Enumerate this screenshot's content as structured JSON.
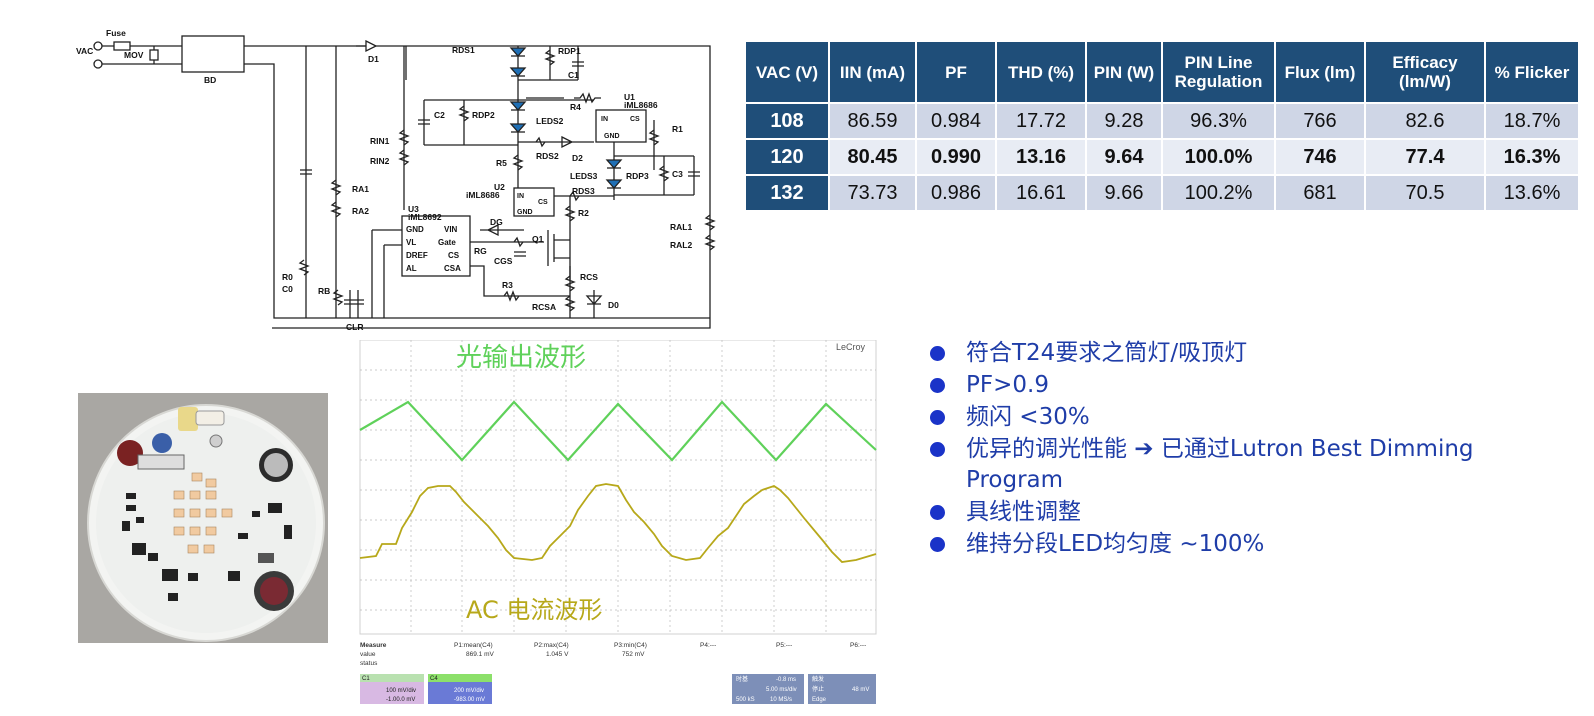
{
  "schematic": {
    "labels": {
      "fuse": "Fuse",
      "vac": "VAC",
      "mov": "MOV",
      "bd": "BD",
      "d1": "D1",
      "rds1": "RDS1",
      "rdp1": "RDP1",
      "c1": "C1",
      "c2": "C2",
      "rdp2": "RDP2",
      "r4": "R4",
      "u1": "U1",
      "u1_part": "iML8686",
      "u1_in": "IN",
      "u1_cs": "CS",
      "u1_gnd": "GND",
      "leds2": "LEDS2",
      "r1": "R1",
      "rin1": "RIN1",
      "rin2": "RIN2",
      "r5": "R5",
      "rds2": "RDS2",
      "d2": "D2",
      "leds3": "LEDS3",
      "rdp3": "RDP3",
      "c3": "C3",
      "u2": "U2",
      "u2_part": "iML8686",
      "u2_in": "IN",
      "u2_cs": "CS",
      "u2_gnd": "GND",
      "rds3": "RDS3",
      "r2": "R2",
      "ra1": "RA1",
      "ra2": "RA2",
      "u3": "U3",
      "u3_part": "iML8692",
      "u3_gnd": "GND",
      "u3_vin": "VIN",
      "u3_vl": "VL",
      "u3_gate": "Gate",
      "u3_dref": "DREF",
      "u3_cs": "CS",
      "u3_al": "AL",
      "u3_csa": "CSA",
      "dg": "DG",
      "q1": "Q1",
      "rg": "RG",
      "cgs": "CGS",
      "ral1": "RAL1",
      "ral2": "RAL2",
      "r0": "R0",
      "c0": "C0",
      "rb": "RB",
      "rcs": "RCS",
      "r3": "R3",
      "rcsa": "RCSA",
      "d0": "D0",
      "clr": "CLR"
    }
  },
  "table": {
    "headers": [
      "VAC (V)",
      "IIN (mA)",
      "PF",
      "THD (%)",
      "PIN (W)",
      "PIN Line Regulation",
      "Flux (lm)",
      "Efficacy (lm/W)",
      "% Flicker"
    ],
    "rows": [
      [
        "108",
        "86.59",
        "0.984",
        "17.72",
        "9.28",
        "96.3%",
        "766",
        "82.6",
        "18.7%"
      ],
      [
        "120",
        "80.45",
        "0.990",
        "13.16",
        "9.64",
        "100.0%",
        "746",
        "77.4",
        "16.3%"
      ],
      [
        "132",
        "73.73",
        "0.986",
        "16.61",
        "9.66",
        "100.2%",
        "681",
        "70.5",
        "13.6%"
      ]
    ]
  },
  "scope": {
    "brand": "LeCroy",
    "light_label": "光输出波形",
    "current_label": "AC 电流波形",
    "light_color": "#5fd15a",
    "current_color": "#b7a81a",
    "measure": {
      "title": "Measure",
      "value": "value",
      "status": "status",
      "p1_name": "P1:mean(C4)",
      "p1_value": "869.1 mV",
      "p2_name": "P2:max(C4)",
      "p2_value": "1.045 V",
      "p3_name": "P3:min(C4)",
      "p3_value": "752 mV",
      "p4": "P4:---",
      "p5": "P5:---",
      "p6": "P6:---"
    },
    "ch1": {
      "name": "C1",
      "line1": "100 mV/div",
      "line2": "-1.00.0 mV"
    },
    "ch4": {
      "name": "C4",
      "line1": "200 mV/div",
      "line2": "-983.00 mV"
    },
    "timebase": {
      "t1": "时基",
      "t1v": "-0.8 ms",
      "t2": "5.00 ms/div",
      "t3": "500 kS",
      "t3v": "10 MS/s"
    },
    "trigger": {
      "t1": "触发",
      "t2": "停止",
      "t3": "48 mV",
      "t4": "Edge"
    }
  },
  "bullets": [
    "符合T24要求之筒灯/吸顶灯",
    "PF>0.9",
    "频闪 <30%",
    "优异的调光性能 ➔ 已通过Lutron Best Dimming Program",
    "具线性调整",
    "维持分段LED均匀度 ~100%"
  ]
}
